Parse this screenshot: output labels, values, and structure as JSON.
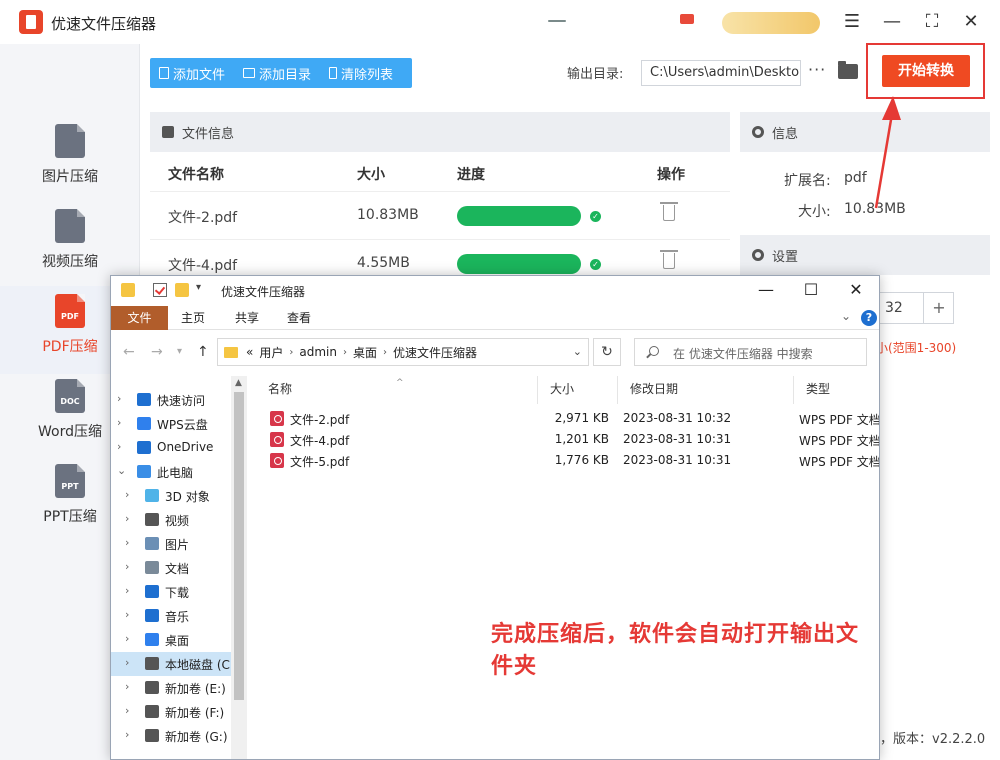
{
  "app": {
    "title": "优速文件压缩器",
    "window_controls": [
      "☰",
      "—",
      "⛶",
      "✕"
    ]
  },
  "sidebar": {
    "items": [
      {
        "label": "图片压缩",
        "icon_text": "",
        "icon": "image-file-icon"
      },
      {
        "label": "视频压缩",
        "icon_text": "",
        "icon": "video-file-icon"
      },
      {
        "label": "PDF压缩",
        "icon_text": "PDF",
        "icon": "pdf-file-icon",
        "active": true
      },
      {
        "label": "Word压缩",
        "icon_text": "DOC",
        "icon": "doc-file-icon"
      },
      {
        "label": "PPT压缩",
        "icon_text": "PPT",
        "icon": "ppt-file-icon"
      }
    ]
  },
  "toolbar": {
    "add_file": "添加文件",
    "add_folder": "添加目录",
    "clear_list": "清除列表",
    "output_label": "输出目录:",
    "output_path": "C:\\Users\\admin\\Desktop",
    "more": "···",
    "start": "开始转换"
  },
  "file_info": {
    "title": "文件信息",
    "columns": [
      "文件名称",
      "大小",
      "进度",
      "操作"
    ],
    "rows": [
      {
        "name": "文件-2.pdf",
        "size": "10.83MB",
        "progress": 1.0
      },
      {
        "name": "文件-4.pdf",
        "size": "4.55MB",
        "progress": 1.0
      }
    ]
  },
  "info_panel": {
    "title": "信息",
    "ext_label": "扩展名:",
    "ext_value": "pdf",
    "size_label": "大小:",
    "size_value": "10.83MB"
  },
  "settings": {
    "title": "设置",
    "value": "32",
    "plus": "+",
    "hint": "小(范围1-300)"
  },
  "version": "，版本：v2.2.2.0",
  "explorer": {
    "title": "优速文件压缩器",
    "ribbon_tabs": [
      "文件",
      "主页",
      "共享",
      "查看"
    ],
    "help": "?",
    "breadcrumb": [
      "«",
      "用户",
      "admin",
      "桌面",
      "优速文件压缩器"
    ],
    "search_placeholder": "在 优速文件压缩器 中搜索",
    "nav_items": [
      {
        "label": "快速访问",
        "icon": "star-icon",
        "color": "#1e6fd0",
        "level": 0
      },
      {
        "label": "WPS云盘",
        "icon": "cloud-icon",
        "color": "#2f80ed",
        "level": 0
      },
      {
        "label": "OneDrive",
        "icon": "onedrive-icon",
        "color": "#1e6fd0",
        "level": 0
      },
      {
        "label": "此电脑",
        "icon": "computer-icon",
        "color": "#3a8ee6",
        "level": 0,
        "expanded": true
      },
      {
        "label": "3D 对象",
        "icon": "cube-icon",
        "color": "#4fb3e8",
        "level": 1
      },
      {
        "label": "视频",
        "icon": "film-icon",
        "color": "#555555",
        "level": 1
      },
      {
        "label": "图片",
        "icon": "picture-icon",
        "color": "#6b8fb5",
        "level": 1
      },
      {
        "label": "文档",
        "icon": "document-icon",
        "color": "#7a8a99",
        "level": 1
      },
      {
        "label": "下载",
        "icon": "download-icon",
        "color": "#1e6fd0",
        "level": 1
      },
      {
        "label": "音乐",
        "icon": "music-icon",
        "color": "#1e6fd0",
        "level": 1
      },
      {
        "label": "桌面",
        "icon": "desktop-icon",
        "color": "#2f80ed",
        "level": 1
      },
      {
        "label": "本地磁盘 (C:)",
        "icon": "drive-icon",
        "color": "#555555",
        "level": 1,
        "selected": true
      },
      {
        "label": "新加卷 (E:)",
        "icon": "drive-icon",
        "color": "#555555",
        "level": 1
      },
      {
        "label": "新加卷 (F:)",
        "icon": "drive-icon",
        "color": "#555555",
        "level": 1
      },
      {
        "label": "新加卷 (G:)",
        "icon": "drive-icon",
        "color": "#555555",
        "level": 1
      }
    ],
    "columns": [
      "名称",
      "大小",
      "修改日期",
      "类型"
    ],
    "files": [
      {
        "name": "文件-2.pdf",
        "size": "2,971 KB",
        "date": "2023-08-31 10:32",
        "type": "WPS PDF 文档"
      },
      {
        "name": "文件-4.pdf",
        "size": "1,201 KB",
        "date": "2023-08-31 10:31",
        "type": "WPS PDF 文档"
      },
      {
        "name": "文件-5.pdf",
        "size": "1,776 KB",
        "date": "2023-08-31 10:31",
        "type": "WPS PDF 文档"
      }
    ],
    "window_controls": [
      "—",
      "☐",
      "✕"
    ]
  },
  "annotation": "完成压缩后，软件会自动打开输出文件夹",
  "colors": {
    "accent": "#ef4a22",
    "toolbar_blue": "#3fa9f5",
    "progress_green": "#1bb55c",
    "annotation_red": "#e53935"
  }
}
